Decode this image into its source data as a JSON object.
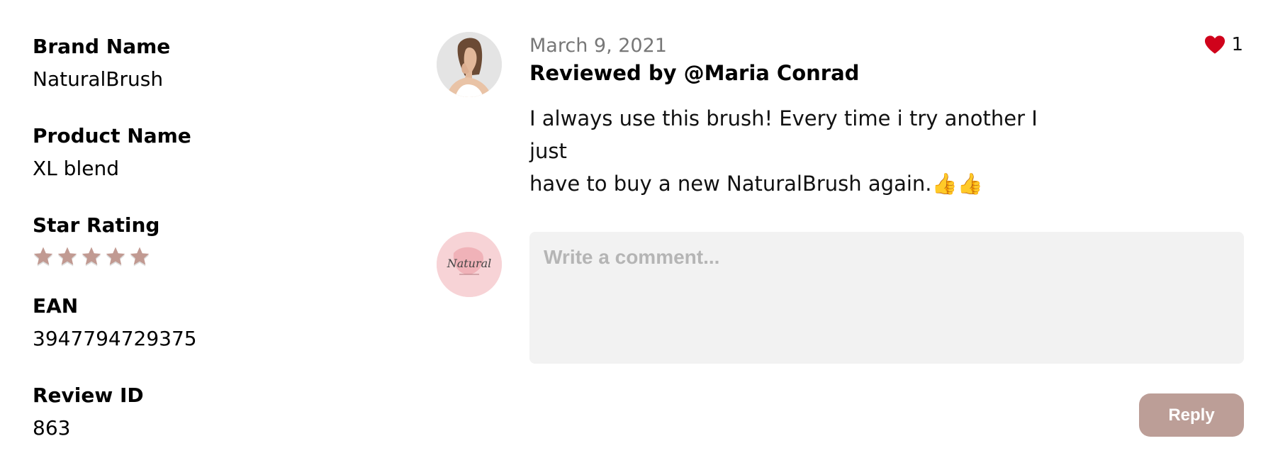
{
  "details": {
    "brand_label": "Brand Name",
    "brand_value": "NaturalBrush",
    "product_label": "Product Name",
    "product_value": "XL blend",
    "rating_label": "Star Rating",
    "rating_value": 5,
    "rating_max": 5,
    "star_color": "#c19a92",
    "ean_label": "EAN",
    "ean_value": "3947794729375",
    "review_id_label": "Review ID",
    "review_id_value": "863"
  },
  "review": {
    "date": "March 9, 2021",
    "author": "Reviewed by @Maria Conrad",
    "text_line1": "I always use this brush! Every time i try another I just",
    "text_line2": "have to buy a new NaturalBrush again.👍👍",
    "likes": "1",
    "like_icon": "heart-icon",
    "like_color": "#d0021b"
  },
  "comment": {
    "placeholder": "Write a comment...",
    "value": "",
    "brand_avatar_text": "Natural"
  },
  "reply": {
    "label": "Reply",
    "color": "#bc9e97"
  }
}
